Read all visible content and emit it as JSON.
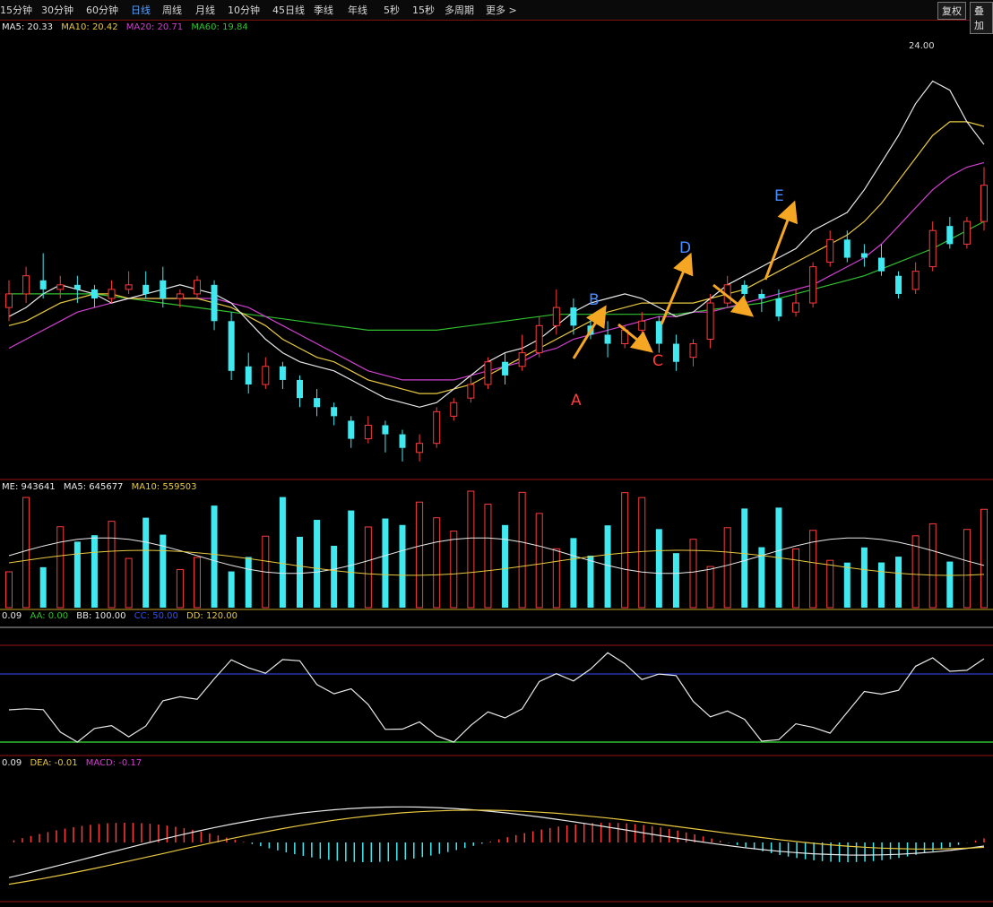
{
  "toolbar": {
    "tabs": [
      "15分钟",
      "30分钟",
      "60分钟",
      "日线",
      "周线",
      "月线",
      "10分钟",
      "45日线",
      "季线",
      "年线",
      "5秒",
      "15秒",
      "多周期",
      "更多 >"
    ],
    "active_tab": "日线",
    "right_buttons": [
      "复权",
      "叠加"
    ]
  },
  "legends": {
    "price": [
      {
        "text": "MA5: 20.33",
        "color": "#e8e8e8"
      },
      {
        "text": "MA10: 20.42",
        "color": "#e8c840"
      },
      {
        "text": "MA20: 20.71",
        "color": "#d040d0"
      },
      {
        "text": "MA60: 19.84",
        "color": "#30c030"
      }
    ],
    "volume": [
      {
        "text": "ME: 943641",
        "color": "#e8e8e8"
      },
      {
        "text": "MA5: 645677",
        "color": "#e8e8e8"
      },
      {
        "text": "MA10: 559503",
        "color": "#e8c840"
      }
    ],
    "indicator": [
      {
        "text": "0.09",
        "color": "#e8e8e8"
      },
      {
        "text": "AA: 0.00",
        "color": "#30c030"
      },
      {
        "text": "BB: 100.00",
        "color": "#e8e8e8"
      },
      {
        "text": "CC: 50.00",
        "color": "#3050ff"
      },
      {
        "text": "DD: 120.00",
        "color": "#e8c840"
      }
    ],
    "macd": [
      {
        "text": "0.09",
        "color": "#e8e8e8"
      },
      {
        "text": "DEA: -0.01",
        "color": "#e8c840"
      },
      {
        "text": "MACD: -0.17",
        "color": "#d040d0"
      }
    ]
  },
  "colors": {
    "up": "#ff3b3b",
    "down": "#40e8f0",
    "ma5": "#e8e8e8",
    "ma10": "#e8c840",
    "ma20": "#d040d0",
    "ma60": "#30c030",
    "arrow": "#f5a623",
    "panel_border": "#7a1010"
  },
  "annotations": [
    {
      "label": "A",
      "color": "#ff3b3b"
    },
    {
      "label": "B",
      "color": "#4a8cff"
    },
    {
      "label": "C",
      "color": "#ff3b3b"
    },
    {
      "label": "D",
      "color": "#4a8cff"
    },
    {
      "label": "E",
      "color": "#4a8cff"
    }
  ],
  "peak_label": "24.00",
  "chart_data": {
    "type": "candlestick",
    "ma5": [
      18.4,
      18.6,
      18.9,
      19.1,
      19.0,
      18.9,
      18.7,
      18.8,
      18.9,
      19.0,
      19.1,
      19.0,
      18.9,
      18.7,
      18.3,
      17.9,
      17.6,
      17.4,
      17.3,
      17.2,
      17.0,
      16.8,
      16.6,
      16.5,
      16.4,
      16.5,
      16.8,
      17.1,
      17.4,
      17.6,
      17.7,
      17.9,
      18.2,
      18.5,
      18.7,
      18.8,
      18.9,
      18.8,
      18.6,
      18.4,
      18.5,
      18.8,
      19.1,
      19.3,
      19.5,
      19.7,
      19.9,
      20.3,
      20.5,
      20.7,
      21.2,
      21.8,
      22.4,
      23.1,
      23.6,
      23.4,
      22.7,
      22.2
    ],
    "ma10": [
      18.2,
      18.3,
      18.5,
      18.7,
      18.8,
      18.9,
      18.9,
      18.8,
      18.8,
      18.8,
      18.8,
      18.8,
      18.7,
      18.6,
      18.4,
      18.2,
      17.9,
      17.7,
      17.5,
      17.4,
      17.2,
      17.0,
      16.9,
      16.8,
      16.7,
      16.7,
      16.8,
      16.9,
      17.1,
      17.3,
      17.5,
      17.7,
      17.9,
      18.1,
      18.3,
      18.5,
      18.6,
      18.7,
      18.7,
      18.7,
      18.7,
      18.8,
      18.9,
      19.0,
      19.2,
      19.4,
      19.6,
      19.8,
      20.0,
      20.2,
      20.5,
      20.9,
      21.4,
      21.9,
      22.4,
      22.7,
      22.7,
      22.6
    ],
    "ma20": [
      17.7,
      17.9,
      18.1,
      18.3,
      18.5,
      18.6,
      18.7,
      18.8,
      18.8,
      18.8,
      18.8,
      18.8,
      18.8,
      18.7,
      18.6,
      18.4,
      18.2,
      18.0,
      17.8,
      17.6,
      17.4,
      17.2,
      17.1,
      17.0,
      17.0,
      17.0,
      17.0,
      17.1,
      17.2,
      17.3,
      17.4,
      17.6,
      17.7,
      17.9,
      18.0,
      18.1,
      18.2,
      18.3,
      18.4,
      18.4,
      18.5,
      18.5,
      18.6,
      18.7,
      18.8,
      18.9,
      19.0,
      19.1,
      19.3,
      19.5,
      19.7,
      20.0,
      20.4,
      20.8,
      21.2,
      21.5,
      21.7,
      21.8
    ],
    "ma60": [
      18.9,
      18.9,
      18.9,
      18.9,
      18.9,
      18.9,
      18.85,
      18.8,
      18.75,
      18.7,
      18.65,
      18.6,
      18.55,
      18.5,
      18.45,
      18.4,
      18.35,
      18.3,
      18.25,
      18.2,
      18.15,
      18.1,
      18.1,
      18.1,
      18.1,
      18.1,
      18.15,
      18.2,
      18.25,
      18.3,
      18.35,
      18.4,
      18.45,
      18.45,
      18.45,
      18.45,
      18.45,
      18.45,
      18.45,
      18.45,
      18.5,
      18.55,
      18.6,
      18.65,
      18.7,
      18.8,
      18.9,
      19.0,
      19.1,
      19.2,
      19.3,
      19.45,
      19.6,
      19.75,
      19.9,
      20.1,
      20.3,
      20.5
    ],
    "candles": [
      [
        18.6,
        18.9,
        18.3,
        19.2
      ],
      [
        18.9,
        19.3,
        18.7,
        19.5
      ],
      [
        19.2,
        19.0,
        18.8,
        19.8
      ],
      [
        19.0,
        19.1,
        18.8,
        19.3
      ],
      [
        19.1,
        19.0,
        18.7,
        19.3
      ],
      [
        19.0,
        18.8,
        18.6,
        19.1
      ],
      [
        18.8,
        19.0,
        18.7,
        19.2
      ],
      [
        19.0,
        19.1,
        18.9,
        19.4
      ],
      [
        19.1,
        18.9,
        18.8,
        19.4
      ],
      [
        19.2,
        18.8,
        18.6,
        19.5
      ],
      [
        18.8,
        18.9,
        18.6,
        19.0
      ],
      [
        18.9,
        19.2,
        18.8,
        19.3
      ],
      [
        19.1,
        18.3,
        18.1,
        19.2
      ],
      [
        18.3,
        17.2,
        17.0,
        18.5
      ],
      [
        17.3,
        16.9,
        16.7,
        17.6
      ],
      [
        16.9,
        17.3,
        16.8,
        17.5
      ],
      [
        17.3,
        17.0,
        16.8,
        17.4
      ],
      [
        17.0,
        16.6,
        16.4,
        17.1
      ],
      [
        16.6,
        16.4,
        16.2,
        16.8
      ],
      [
        16.4,
        16.2,
        16.0,
        16.5
      ],
      [
        16.1,
        15.7,
        15.5,
        16.2
      ],
      [
        15.7,
        16.0,
        15.6,
        16.2
      ],
      [
        16.0,
        15.8,
        15.4,
        16.1
      ],
      [
        15.8,
        15.5,
        15.2,
        15.9
      ],
      [
        15.4,
        15.6,
        15.2,
        15.8
      ],
      [
        15.6,
        16.3,
        15.5,
        16.4
      ],
      [
        16.2,
        16.5,
        16.1,
        16.6
      ],
      [
        16.6,
        16.9,
        16.5,
        17.1
      ],
      [
        16.9,
        17.4,
        16.8,
        17.5
      ],
      [
        17.4,
        17.1,
        16.9,
        17.6
      ],
      [
        17.3,
        17.6,
        17.2,
        18.0
      ],
      [
        17.6,
        18.2,
        17.5,
        18.4
      ],
      [
        18.2,
        18.6,
        18.0,
        19.0
      ],
      [
        18.6,
        18.2,
        18.0,
        18.8
      ],
      [
        18.2,
        18.0,
        17.9,
        18.4
      ],
      [
        18.0,
        17.8,
        17.5,
        18.3
      ],
      [
        17.8,
        18.1,
        17.7,
        18.2
      ],
      [
        18.1,
        18.3,
        17.9,
        18.5
      ],
      [
        18.3,
        17.8,
        17.6,
        18.4
      ],
      [
        17.8,
        17.4,
        17.2,
        18.0
      ],
      [
        17.5,
        17.8,
        17.3,
        17.9
      ],
      [
        17.9,
        18.7,
        17.7,
        18.9
      ],
      [
        18.7,
        19.1,
        18.6,
        19.3
      ],
      [
        19.1,
        18.9,
        18.8,
        19.2
      ],
      [
        18.9,
        18.8,
        18.5,
        19.0
      ],
      [
        18.8,
        18.4,
        18.3,
        19.0
      ],
      [
        18.5,
        18.7,
        18.4,
        19.0
      ],
      [
        18.7,
        19.5,
        18.6,
        19.6
      ],
      [
        19.6,
        20.1,
        19.5,
        20.3
      ],
      [
        20.1,
        19.7,
        19.6,
        20.3
      ],
      [
        19.8,
        19.7,
        19.5,
        20.0
      ],
      [
        19.7,
        19.4,
        19.3,
        20.0
      ],
      [
        19.3,
        18.9,
        18.8,
        19.4
      ],
      [
        19.0,
        19.4,
        18.9,
        19.6
      ],
      [
        19.5,
        20.3,
        19.4,
        20.5
      ],
      [
        20.4,
        20.0,
        19.9,
        20.6
      ],
      [
        20.0,
        20.5,
        19.9,
        20.6
      ],
      [
        20.5,
        21.3,
        20.3,
        21.7
      ]
    ],
    "y_range": [
      15.0,
      24.5
    ],
    "series": [
      {
        "name": "MA5"
      },
      {
        "name": "MA10"
      },
      {
        "name": "MA20"
      },
      {
        "name": "MA60"
      }
    ]
  }
}
